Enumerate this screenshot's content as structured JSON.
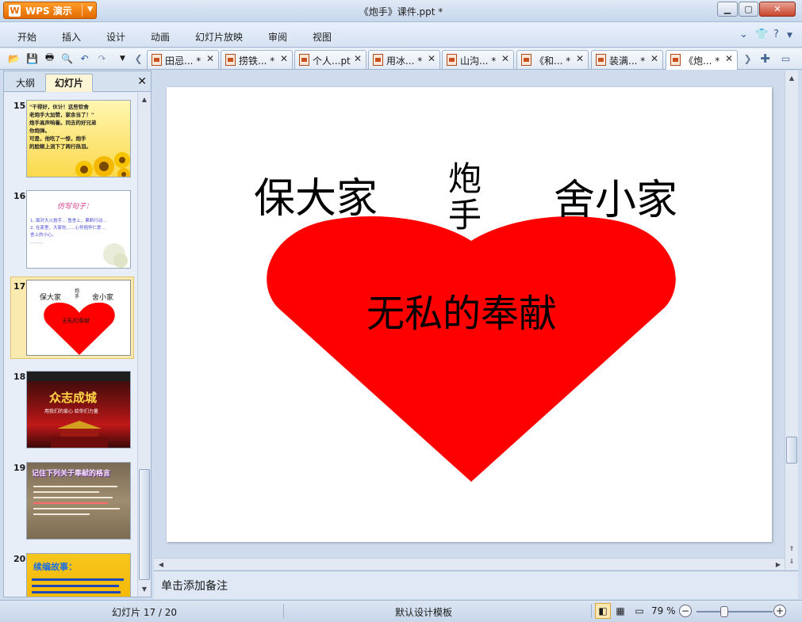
{
  "app": {
    "button_label": "WPS 演示",
    "window_title": "《炮手》课件.ppt *"
  },
  "menu": {
    "items": [
      "开始",
      "插入",
      "设计",
      "动画",
      "幻灯片放映",
      "审阅",
      "视图"
    ]
  },
  "tabs": [
    {
      "label": "田忌... *"
    },
    {
      "label": "捞铁... *"
    },
    {
      "label": "个人...pt"
    },
    {
      "label": "用冰... *"
    },
    {
      "label": "山沟... *"
    },
    {
      "label": "《和... *"
    },
    {
      "label": "装满... *"
    },
    {
      "label": "《炮... *"
    }
  ],
  "left_panel": {
    "tab_outline": "大纲",
    "tab_slides": "幻灯片",
    "thumbs": [
      {
        "num": "15",
        "lines": [
          "\"干得好，伙计！这些钦舍",
          "老炮手大加赞，家余当了！\"",
          "炮手高声响着。同去的好兄弟",
          "你炮弹。",
          "可是，他吃了一惊，炮手",
          "的脸颊上流下了两行热泪。"
        ]
      },
      {
        "num": "16",
        "title": "仿写句子：",
        "lines": [
          "1. 面对大火炮手…  鱼舍上，果断行动…",
          "2. 在家里，大家吃……心怀抱怀仁爱…",
          "舍上的小心。",
          "………"
        ]
      },
      {
        "num": "17",
        "left": "保大家",
        "mid": "炮手",
        "right": "舍小家",
        "heart": "无私的奉献"
      },
      {
        "num": "18",
        "title": "众志成城",
        "subtitle": "用我们的爱心 给你们力量"
      },
      {
        "num": "19",
        "title": "记住下列关于奉献的格言"
      },
      {
        "num": "20",
        "title": "续编故事："
      }
    ]
  },
  "slide": {
    "left_text": "保大家",
    "mid_top": "炮",
    "mid_bottom": "手",
    "right_text": "舍小家",
    "heart_text": "无私的奉献",
    "heart_color": "#ff0000"
  },
  "notes": {
    "placeholder": "单击添加备注"
  },
  "status": {
    "slide_counter": "幻灯片 17 / 20",
    "template": "默认设计模板",
    "zoom": "79 %"
  }
}
